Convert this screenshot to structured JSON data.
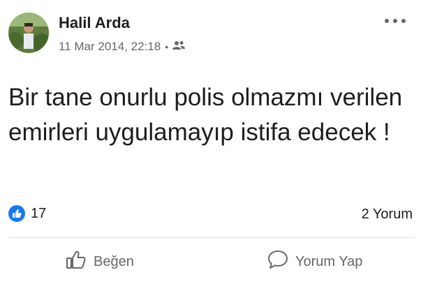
{
  "post": {
    "author": "Halil Arda",
    "timestamp": "11 Mar 2014, 22:18",
    "separator": "•",
    "audience_icon": "friends-icon",
    "text": "Bir tane onurlu polis olmazmı verilen emirleri uygulamayıp istifa edecek !"
  },
  "stats": {
    "reaction_icon": "like-icon",
    "reactions": "17",
    "comments": "2 Yorum"
  },
  "actions": {
    "like": "Beğen",
    "comment": "Yorum Yap"
  },
  "colors": {
    "accent": "#1877f2",
    "secondary_text": "#65676b",
    "divider": "#dadde1"
  }
}
